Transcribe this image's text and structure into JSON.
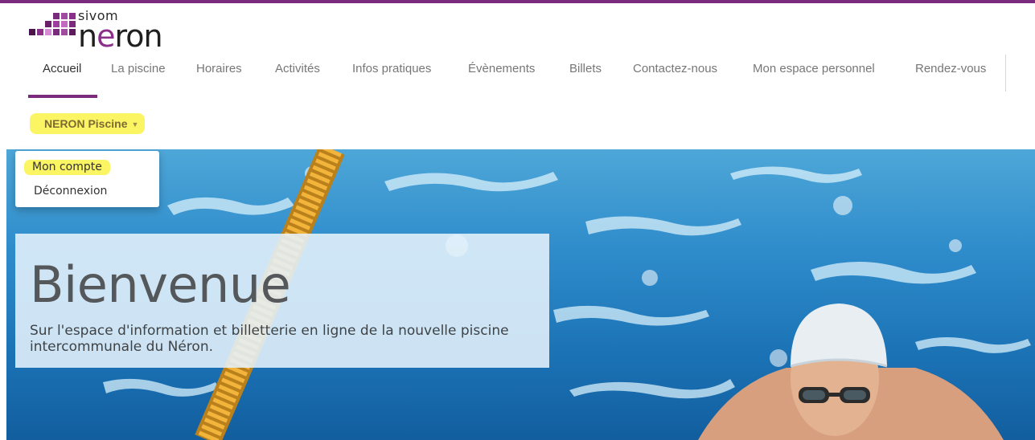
{
  "brand": {
    "top_word": "sivom",
    "main_word": "neron",
    "colors": {
      "primary": "#7b2b7e",
      "dark": "#1f1f1f",
      "highlight": "#fbf463"
    }
  },
  "nav": {
    "items": [
      {
        "label": "Accueil",
        "active": true
      },
      {
        "label": "La piscine"
      },
      {
        "label": "Horaires"
      },
      {
        "label": "Activités"
      },
      {
        "label": "Infos pratiques"
      },
      {
        "label": "Évènements"
      },
      {
        "label": "Billets"
      },
      {
        "label": "Contactez-nous"
      },
      {
        "label": "Mon espace personnel"
      },
      {
        "label": "Rendez-vous"
      }
    ]
  },
  "user_menu": {
    "toggle_label": "NERON Piscine",
    "caret_icon": "caret-down-icon",
    "items": [
      {
        "label": "Mon compte",
        "highlighted": true
      },
      {
        "label": "Déconnexion"
      }
    ]
  },
  "hero": {
    "title": "Bienvenue",
    "text": "Sur l'espace d'information et billetterie en ligne de la nouvelle piscine intercommunale du Néron."
  }
}
